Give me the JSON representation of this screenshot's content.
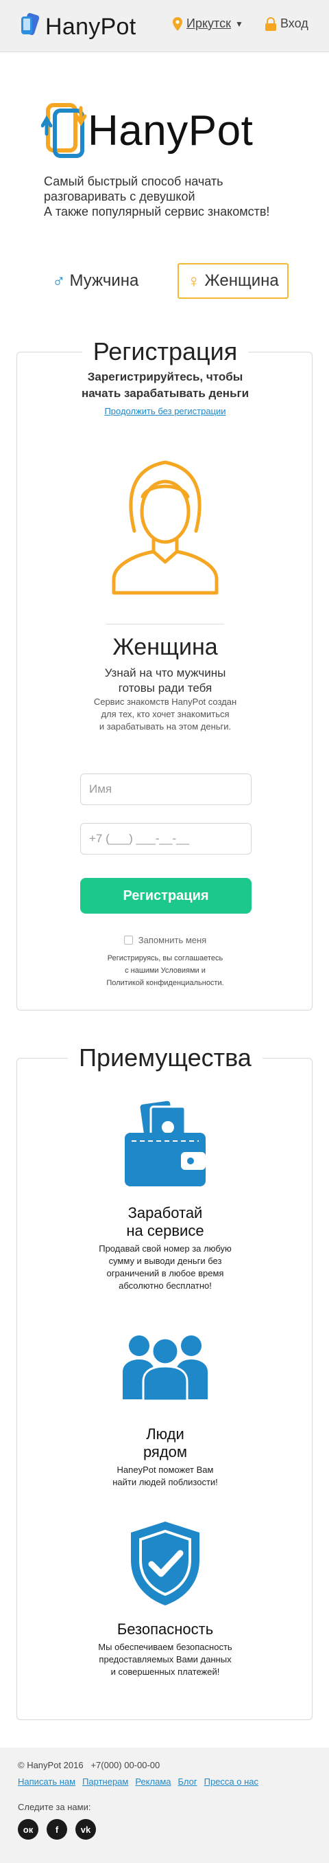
{
  "header": {
    "brand": "HanyPot",
    "city": "Иркутск",
    "login": "Вход"
  },
  "hero": {
    "brand": "HanyPot",
    "tagline_lines": [
      "Самый быстрый способ начать",
      "разговаривать с девушкой",
      "А также популярный сервис знакомств!"
    ]
  },
  "gender": {
    "male": "Мужчина",
    "female": "Женщина",
    "selected": "female"
  },
  "registration": {
    "title": "Регистрация",
    "intro_lines": [
      "Зарегистрируйтесь, чтобы",
      "начать зарабатывать деньги"
    ],
    "skip_link": "Продолжить без регистрации",
    "role": "Женщина",
    "role_sub_lines": [
      "Узнай на что мужчины",
      "готовы ради тебя"
    ],
    "description_lines": [
      "Сервис знакомств HanyPot создан",
      "для тех, кто хочет знакомиться",
      "и зарабатывать на этом деньги."
    ],
    "name_placeholder": "Имя",
    "phone_placeholder": "+7 (___) ___-__-__",
    "submit": "Регистрация",
    "remember": "Запомнить меня",
    "terms_lines": [
      "Регистрируясь, вы соглашаетесь",
      "с нашими Условиями и",
      "Политикой конфиденциальности."
    ]
  },
  "advantages": {
    "title": "Приемущества",
    "items": [
      {
        "icon": "wallet-icon",
        "title_lines": [
          "Заработай",
          "на сервисе"
        ],
        "text_lines": [
          "Продавай свой номер за любую",
          "сумму и выводи деньги без",
          "ограничений в любое время",
          "абсолютно бесплатно!"
        ]
      },
      {
        "icon": "people-icon",
        "title_lines": [
          "Люди",
          "рядом"
        ],
        "text_lines": [
          "HaneyPot поможет Вам",
          "найти людей поблизости!"
        ]
      },
      {
        "icon": "shield-check-icon",
        "title_lines": [
          "Безопасность"
        ],
        "text_lines": [
          "Мы обеспечиваем безопасность",
          "предоставляемых Вами данных",
          "и совершенных платежей!"
        ]
      }
    ]
  },
  "footer": {
    "copyright": "© HanyPot 2016",
    "phone": "+7(000) 00-00-00",
    "links": [
      "Написать нам",
      "Партнерам",
      "Реклама",
      "Блог",
      "Пресса о нас"
    ],
    "follow": "Следите за нами:",
    "social": [
      "odnoklassniki-icon",
      "facebook-icon",
      "vk-icon"
    ],
    "social_glyphs": [
      "ок",
      "f",
      "vk"
    ]
  },
  "colors": {
    "brand_blue": "#1e88c8",
    "brand_orange": "#f5a623",
    "button_green": "#1cc98b"
  }
}
